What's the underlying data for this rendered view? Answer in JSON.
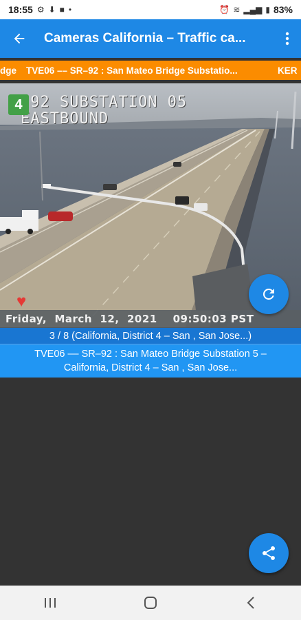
{
  "status_bar": {
    "time": "18:55",
    "battery": "83%",
    "icons": [
      "settings-icon",
      "download-icon",
      "notification-icon",
      "dot-icon",
      "alarm-icon",
      "wifi-icon",
      "signal-icon",
      "battery-icon"
    ]
  },
  "app_bar": {
    "title": "Cameras California – Traffic ca...",
    "back_icon": "arrow-back-icon",
    "menu_icon": "more-vert-icon"
  },
  "ticker": {
    "prev": "dge",
    "current": "TVE06 –– SR–92 : San Mateo Bridge Substatio...",
    "next": "KER"
  },
  "camera": {
    "overlay_line1": " 92 SUBSTATION 05",
    "overlay_line2": "EASTBOUND",
    "badge": "4",
    "timestamp": "Friday,  March  12,  2021    09:50:03 PST"
  },
  "pager": {
    "text": "3 / 8 (California, District  4 – San , San Jose...)"
  },
  "description": {
    "line1": "TVE06 –– SR–92 : San Mateo Bridge Substation 5 –",
    "line2": "California, District  4 – San , San Jose..."
  },
  "colors": {
    "primary": "#1e88e5",
    "ticker": "#fb8c00",
    "badge": "#43a047",
    "heart": "#e53935",
    "background": "#333333"
  }
}
